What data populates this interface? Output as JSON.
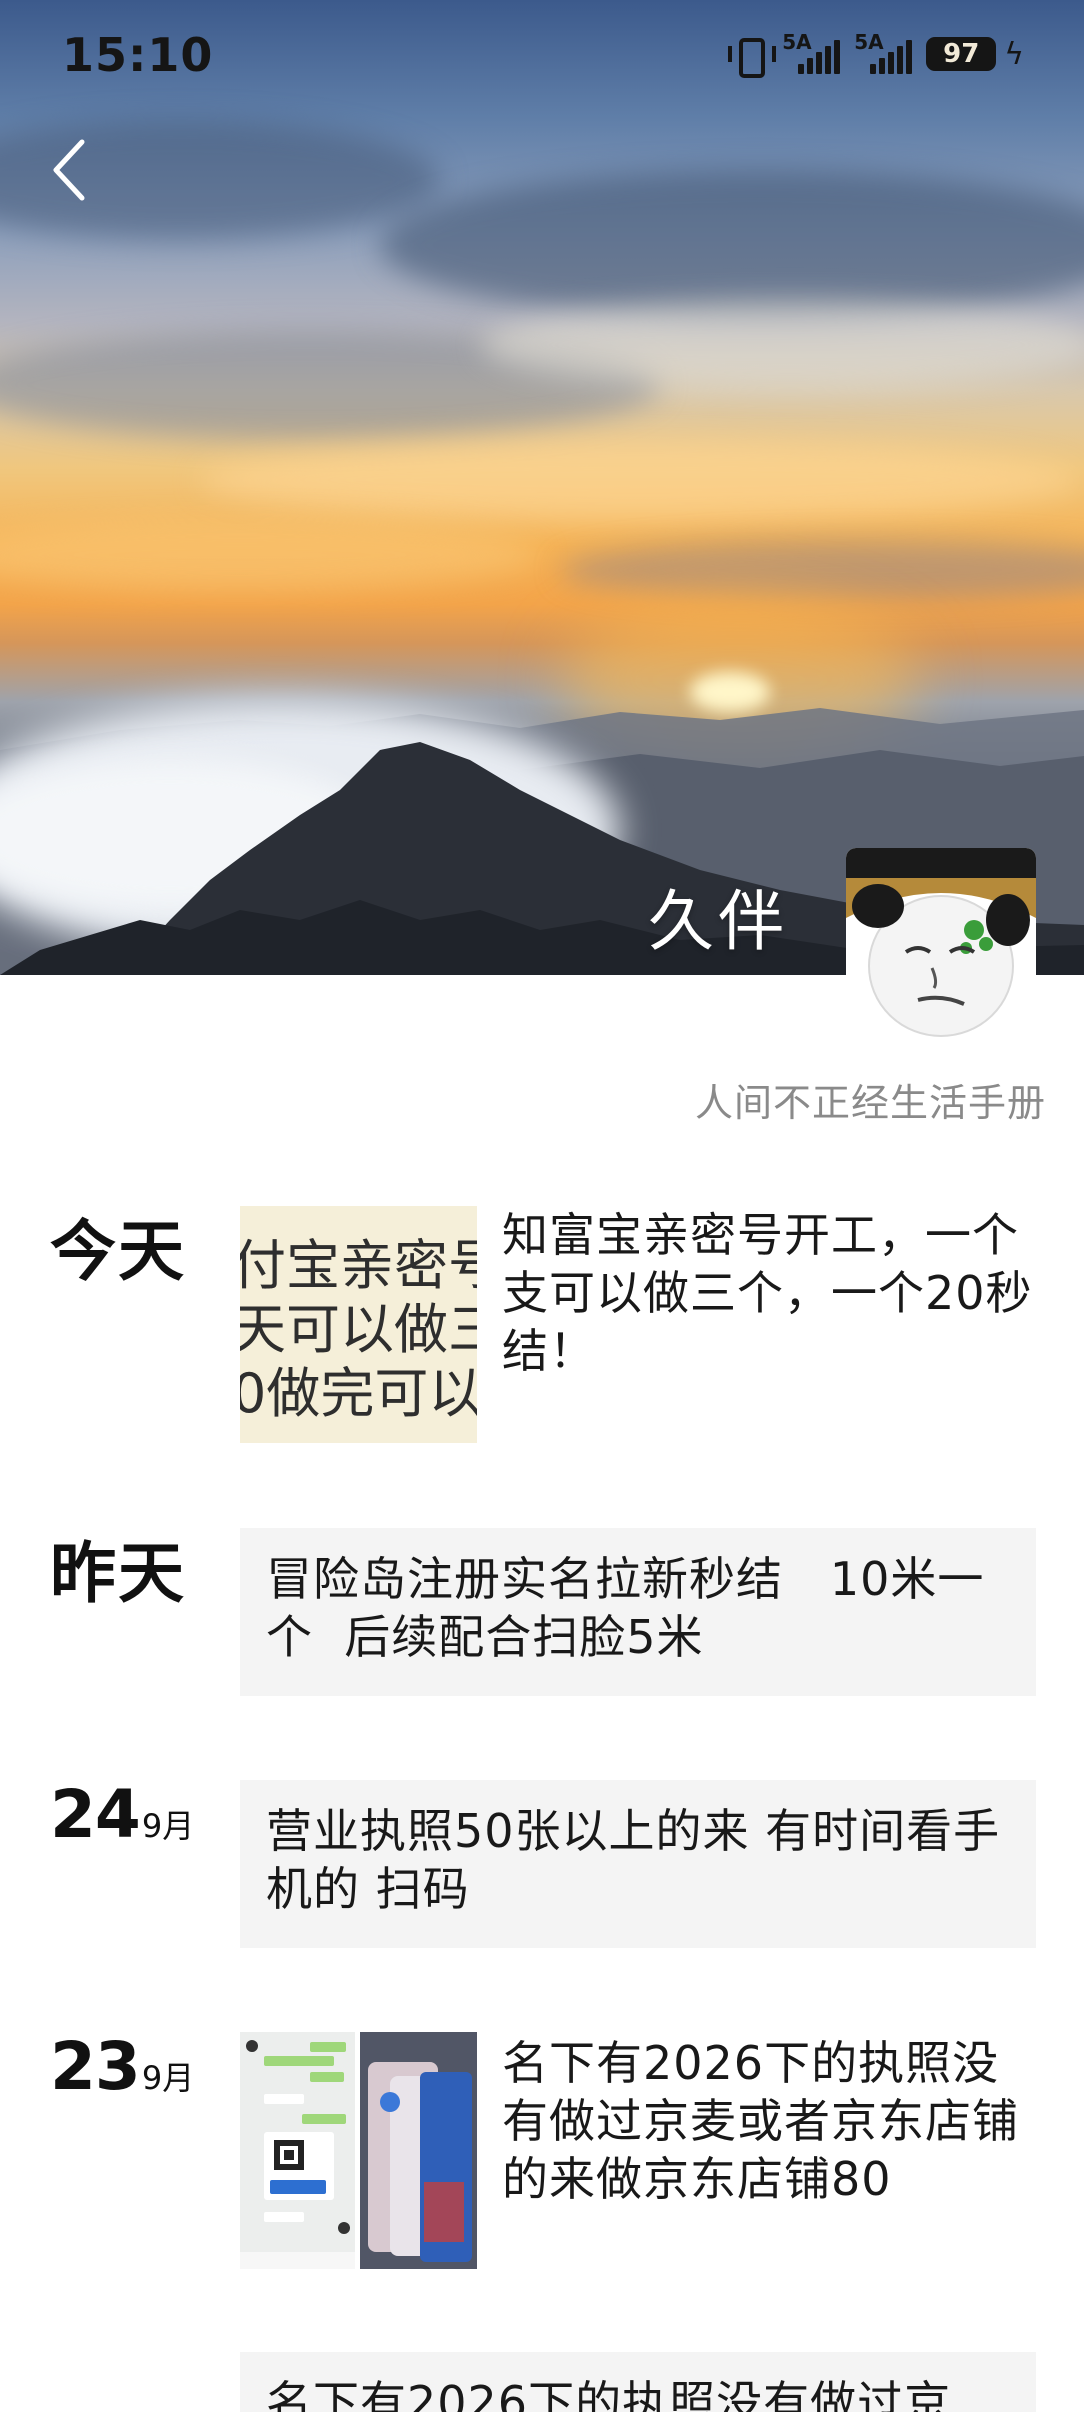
{
  "status_bar": {
    "time": "15:10",
    "signal1_tag": "5A",
    "signal2_tag": "5A",
    "battery": "97",
    "charging_icon": "bolt-icon",
    "vibrate_icon": "vibrate-icon"
  },
  "header": {
    "back_icon": "chevron-left-icon",
    "nickname": "久伴",
    "signature": "人间不正经生活手册"
  },
  "colors": {
    "card_bg": "#f4f4f4",
    "signature_text": "#8a8a8a",
    "background": "#ffffff"
  },
  "timeline": [
    {
      "date_word": "今天",
      "thumbnail_lines": [
        "付宝亲密号",
        "天可以做三",
        "0做完可以"
      ],
      "text": "知富宝亲密号开工，一个支可以做三个，一个20秒结！"
    },
    {
      "date_word": "昨天",
      "text": "冒险岛注册实名拉新秒结   10米一个  后续配合扫脸5米"
    },
    {
      "date_day": "24",
      "date_month": "9月",
      "text": "营业执照50张以上的来 有时间看手机的 扫码"
    },
    {
      "date_day": "23",
      "date_month": "9月",
      "text": "名下有2026下的执照没有做过京麦或者京东店铺的来做京东店铺80"
    },
    {
      "text": "名下有2026下的执照没有做过京"
    }
  ]
}
